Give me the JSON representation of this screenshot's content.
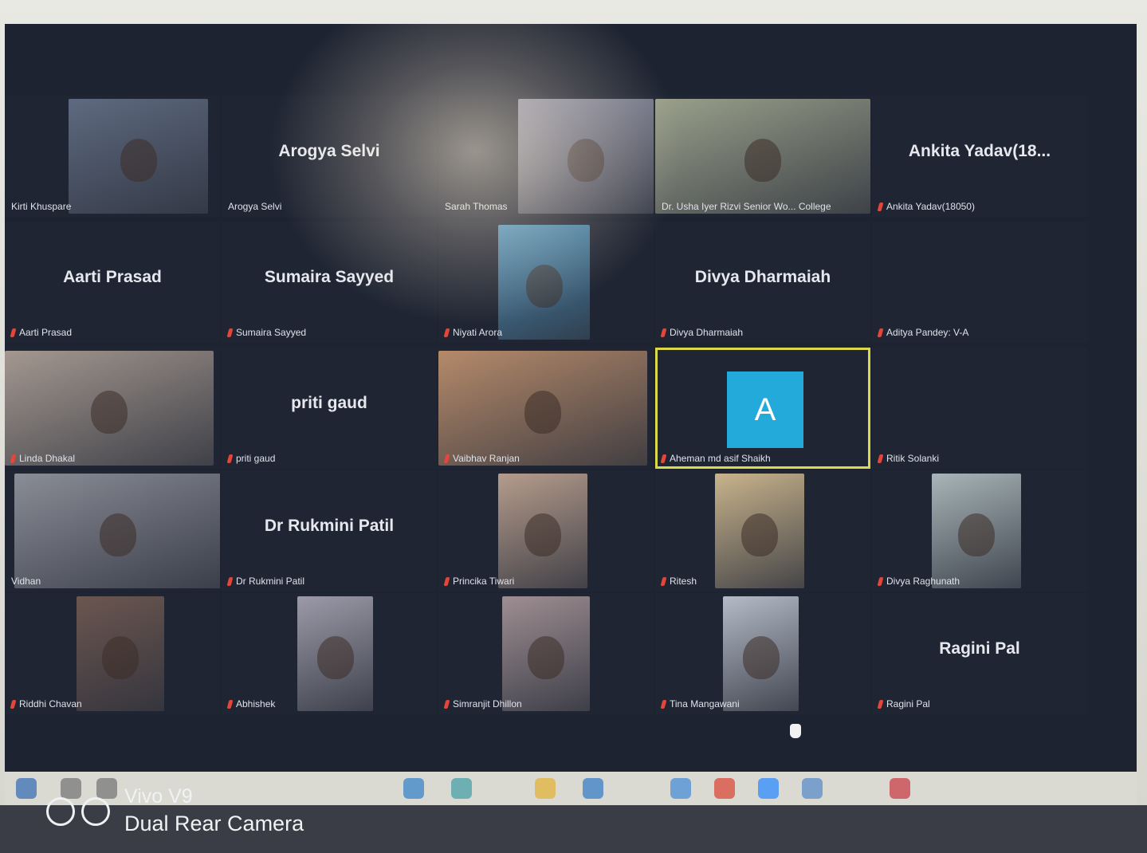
{
  "watermark": {
    "model": "Vivo V9",
    "camera": "Dual Rear Camera"
  },
  "gallery": {
    "rows": [
      [
        {
          "label": "Kirti Khuspare",
          "big_name": "",
          "type": "video",
          "tone": "#5e6a80"
        },
        {
          "label": "Arogya Selvi",
          "big_name": "Arogya Selvi",
          "type": "name",
          "muted": false
        },
        {
          "label": "Sarah Thomas",
          "big_name": "",
          "type": "video",
          "tone": "#8c8fa3"
        },
        {
          "label": "Dr. Usha Iyer Rizvi Senior Wo... College",
          "big_name": "",
          "type": "video",
          "tone": "#9aa08b"
        },
        {
          "label": "Ankita Yadav(18050)",
          "big_name": "Ankita  Yadav(18...",
          "type": "name",
          "muted": true
        }
      ],
      [
        {
          "label": "Aarti Prasad",
          "big_name": "Aarti Prasad",
          "type": "name",
          "muted": true
        },
        {
          "label": "Sumaira Sayyed",
          "big_name": "Sumaira Sayyed",
          "type": "name",
          "muted": true
        },
        {
          "label": "Niyati Arora",
          "big_name": "",
          "type": "video",
          "tone": "#4c8fb8",
          "muted": true
        },
        {
          "label": "Divya Dharmaiah",
          "big_name": "Divya Dharmaiah",
          "type": "name",
          "muted": true
        },
        {
          "label": "Aditya Pandey: V-A",
          "big_name": "",
          "type": "name",
          "muted": true
        }
      ],
      [
        {
          "label": "Linda Dhakal",
          "big_name": "",
          "type": "video",
          "tone": "#a49890",
          "muted": true
        },
        {
          "label": "priti gaud",
          "big_name": "priti gaud",
          "type": "name",
          "muted": true
        },
        {
          "label": "Vaibhav Ranjan",
          "big_name": "",
          "type": "video",
          "tone": "#b58a6a",
          "muted": true
        },
        {
          "label": "Aheman md asif Shaikh",
          "big_name": "",
          "type": "avatar",
          "avatar_letter": "A",
          "speaking": true,
          "muted": true
        },
        {
          "label": "Ritik Solanki",
          "big_name": "",
          "type": "name",
          "muted": true
        }
      ],
      [
        {
          "label": "Vidhan",
          "big_name": "",
          "type": "video",
          "tone": "#8a8c96"
        },
        {
          "label": "Dr Rukmini Patil",
          "big_name": "Dr Rukmini Patil",
          "type": "name",
          "muted": true
        },
        {
          "label": "Princika Tiwari",
          "big_name": "",
          "type": "video",
          "tone": "#b59c8c",
          "muted": true
        },
        {
          "label": "Ritesh",
          "big_name": "",
          "type": "video",
          "tone": "#c8b38c",
          "muted": true
        },
        {
          "label": "Divya Raghunath",
          "big_name": "",
          "type": "video",
          "tone": "#a8b5b8",
          "muted": true
        }
      ],
      [
        {
          "label": "Riddhi Chavan",
          "big_name": "",
          "type": "video",
          "tone": "#6b5650",
          "muted": true
        },
        {
          "label": "Abhishek",
          "big_name": "",
          "type": "video",
          "tone": "#9c9aa8",
          "muted": true
        },
        {
          "label": "Simranjit Dhillon",
          "big_name": "",
          "type": "video",
          "tone": "#9e8e92",
          "muted": true
        },
        {
          "label": "Tina Mangawani",
          "big_name": "",
          "type": "video",
          "tone": "#b4bbc6",
          "muted": true
        },
        {
          "label": "Ragini Pal",
          "big_name": "Ragini Pal",
          "type": "name",
          "muted": true
        }
      ]
    ]
  },
  "taskbar": {
    "icons": [
      "start-icon",
      "search-icon",
      "task-view-icon",
      "edge-icon",
      "store-icon",
      "explorer-icon",
      "mail-icon",
      "photos-icon",
      "chrome-icon",
      "zoom-icon",
      "settings-icon",
      "app-icon"
    ]
  }
}
